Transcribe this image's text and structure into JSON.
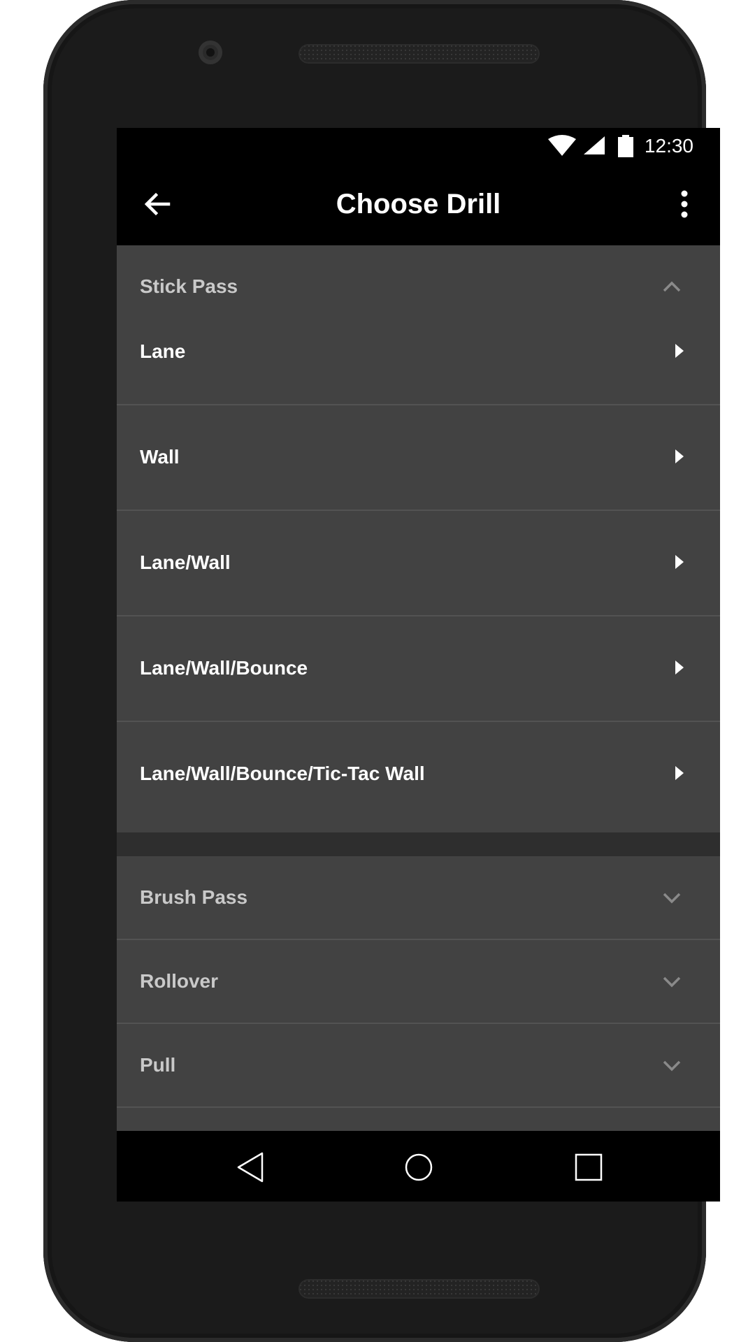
{
  "status_bar": {
    "time": "12:30",
    "icons": [
      "wifi-icon",
      "signal-icon",
      "battery-icon"
    ]
  },
  "app_bar": {
    "title": "Choose Drill",
    "back_icon": "arrow-back-icon",
    "menu_icon": "more-vert-icon"
  },
  "expanded_group": {
    "label": "Stick Pass",
    "state_icon": "chevron-up-icon",
    "items": [
      {
        "label": "Lane"
      },
      {
        "label": "Wall"
      },
      {
        "label": "Lane/Wall"
      },
      {
        "label": "Lane/Wall/Bounce"
      },
      {
        "label": "Lane/Wall/Bounce/Tic-Tac Wall"
      }
    ]
  },
  "collapsed_groups": [
    {
      "label": "Brush Pass"
    },
    {
      "label": "Rollover"
    },
    {
      "label": "Pull"
    }
  ],
  "nav_bar": {
    "icons": [
      "back-triangle-icon",
      "home-circle-icon",
      "recents-square-icon"
    ]
  },
  "colors": {
    "app_bar": "#000000",
    "card": "#424242",
    "background": "#2e2e2e",
    "header_text": "#c9c9c9",
    "item_text": "#ffffff"
  }
}
